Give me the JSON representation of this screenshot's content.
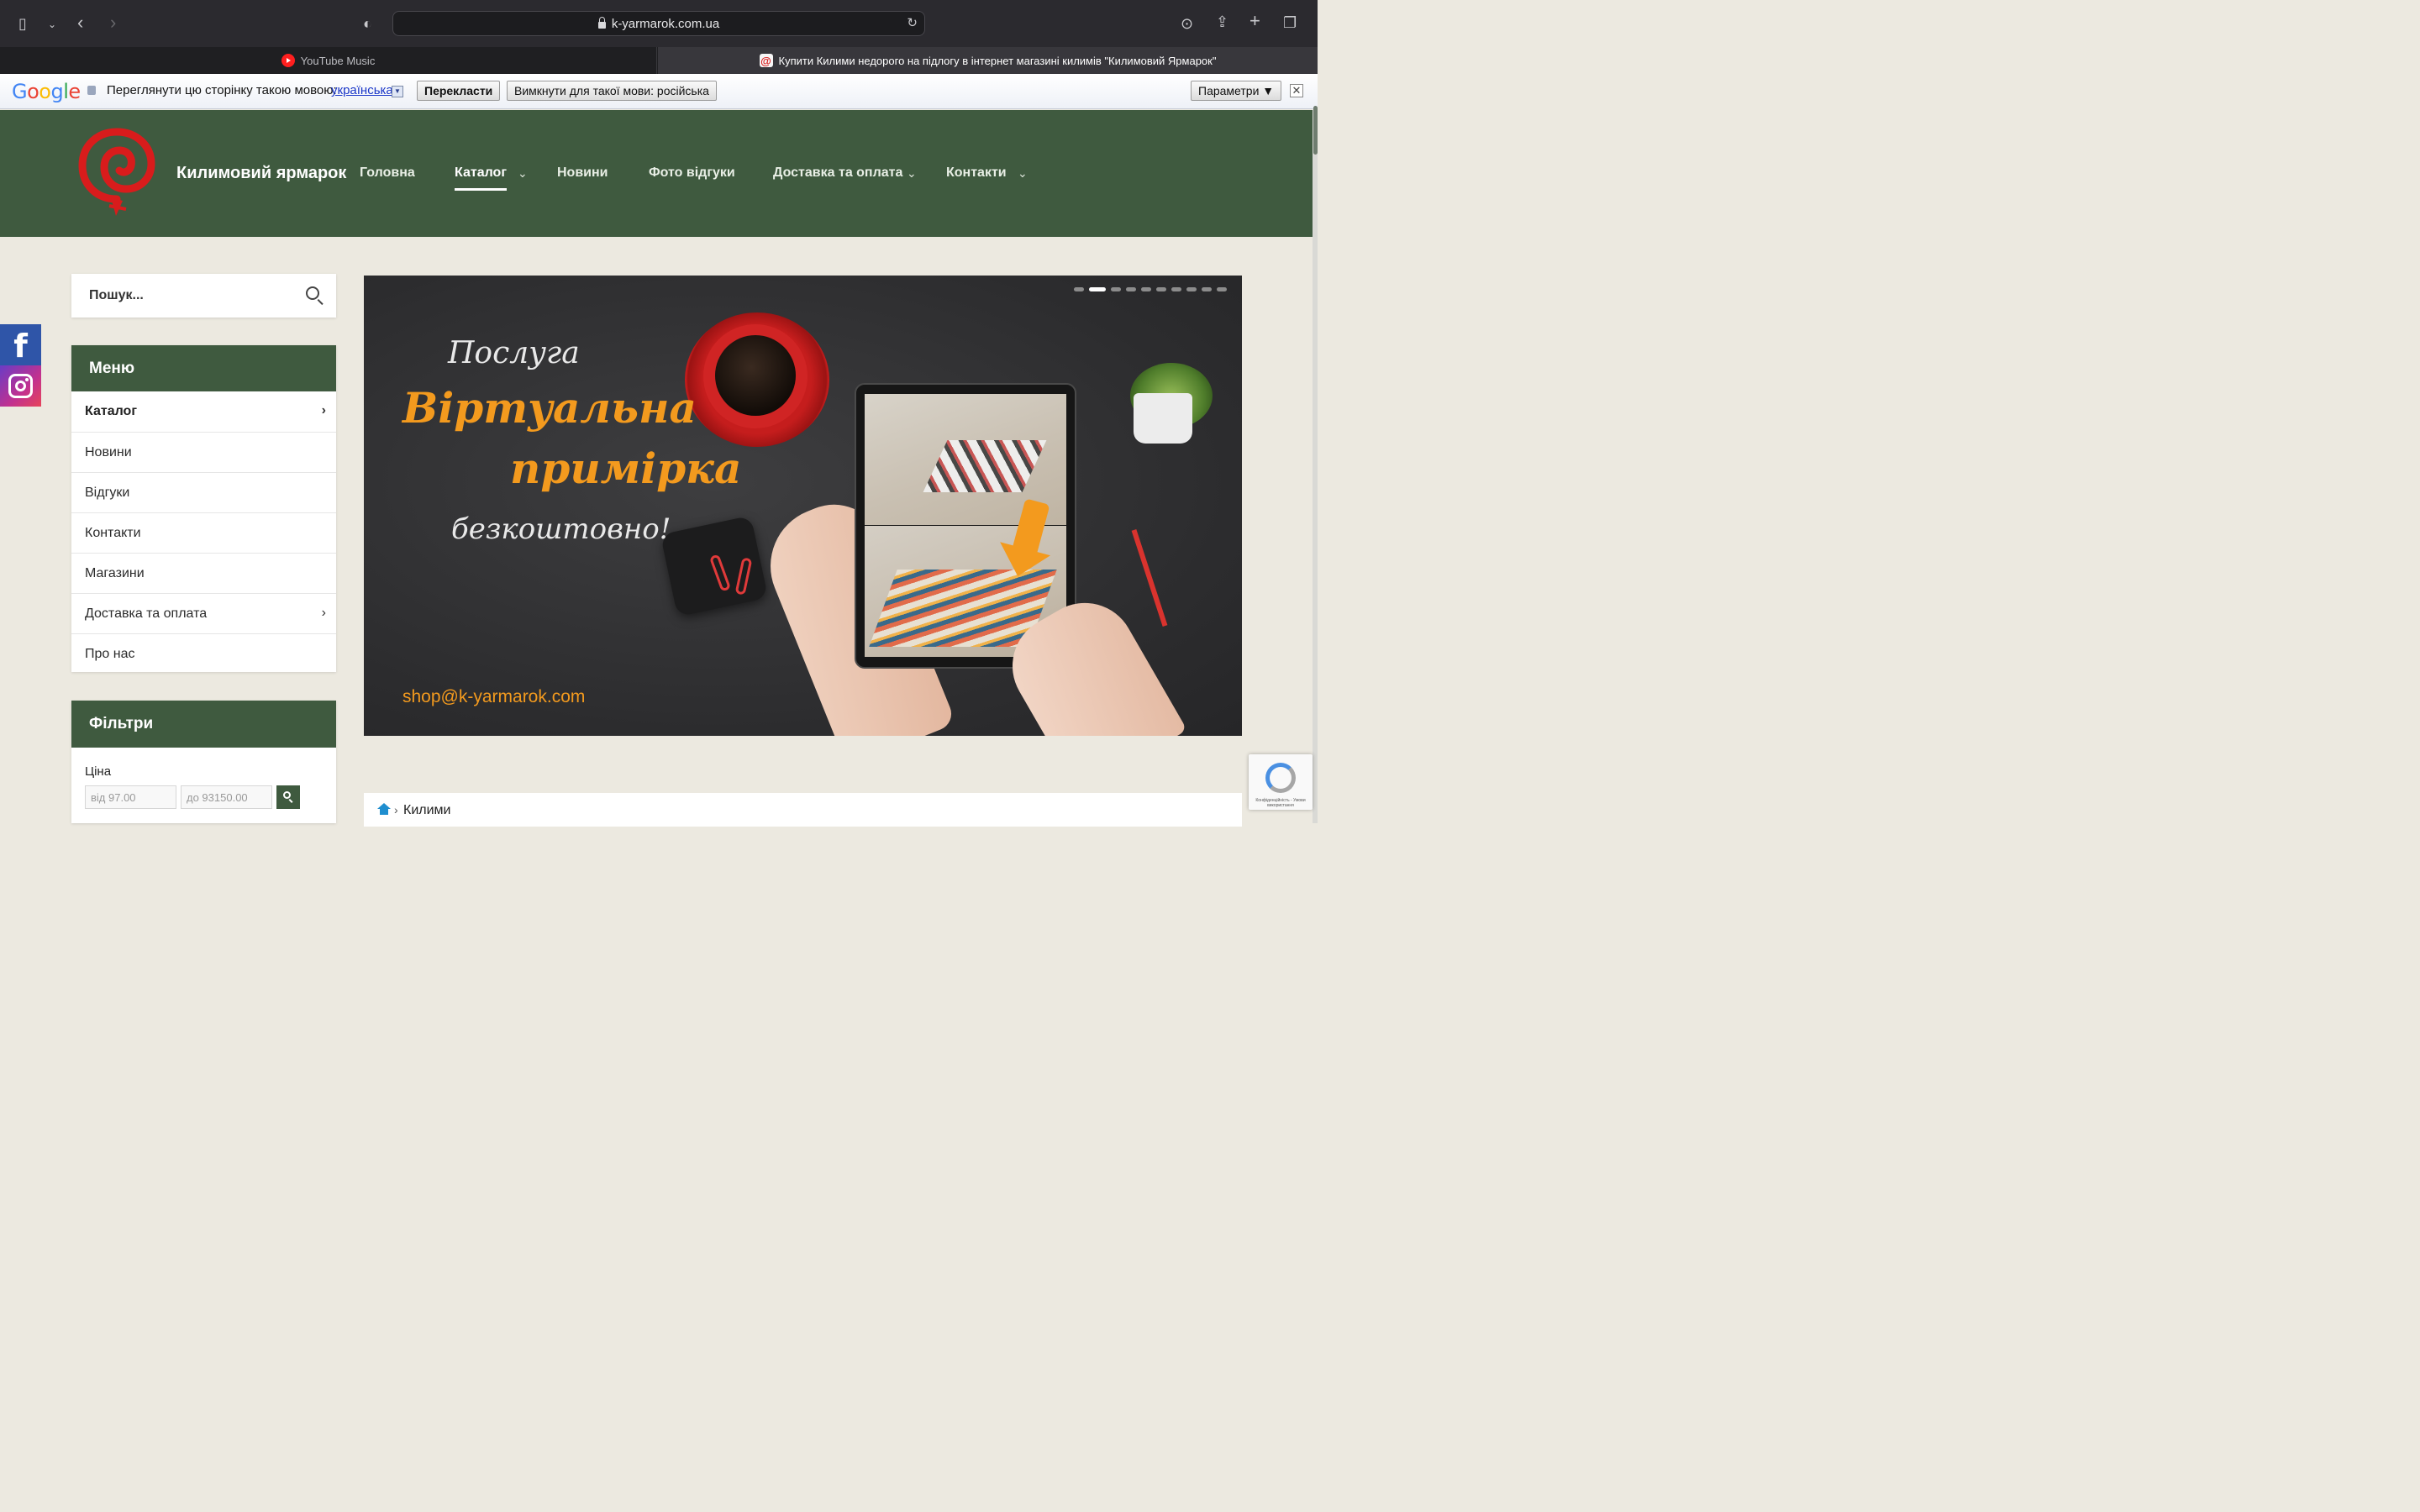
{
  "browser": {
    "url": "k-yarmarok.com.ua",
    "tabs": [
      {
        "label": "YouTube Music",
        "active": false
      },
      {
        "label": "Купити Килими недорого на підлогу в інтернет магазині килимів \"Килимовий Ярмарок\"",
        "active": true
      }
    ]
  },
  "translate_bar": {
    "brand": "Google",
    "prompt": "Переглянути цю сторінку такою мовою:",
    "language": "українська",
    "translate_button": "Перекласти",
    "disable_button": "Вимкнути для такої мови: російська",
    "options_button": "Параметри ▼",
    "close": "✕"
  },
  "site": {
    "brand": "Килимовий ярмарок",
    "nav": [
      {
        "label": "Головна",
        "active": false,
        "dropdown": false
      },
      {
        "label": "Каталог",
        "active": true,
        "dropdown": true
      },
      {
        "label": "Новини",
        "active": false,
        "dropdown": false
      },
      {
        "label": "Фото відгуки",
        "active": false,
        "dropdown": false
      },
      {
        "label": "Доставка та оплата",
        "active": false,
        "dropdown": true
      },
      {
        "label": "Контакти",
        "active": false,
        "dropdown": true
      }
    ],
    "colors": {
      "header": "#3f5a3f",
      "accent": "#f39a1e",
      "logo": "#d81c1c"
    }
  },
  "social": {
    "facebook": "f",
    "instagram": "instagram-icon"
  },
  "sidebar": {
    "search": {
      "placeholder": "Пошук..."
    },
    "menu": {
      "title": "Меню",
      "items": [
        {
          "label": "Каталог",
          "arrow": true
        },
        {
          "label": "Новини",
          "arrow": false
        },
        {
          "label": "Відгуки",
          "arrow": false
        },
        {
          "label": "Контакти",
          "arrow": false
        },
        {
          "label": "Магазини",
          "arrow": false
        },
        {
          "label": "Доставка та оплата",
          "arrow": true
        },
        {
          "label": "Про нас",
          "arrow": false
        }
      ]
    },
    "filters": {
      "title": "Фільтри",
      "price_label": "Ціна",
      "price_from": "від 97.00",
      "price_to": "до 93150.00"
    }
  },
  "banner": {
    "line1": "Послуга",
    "line2": "Віртуальна",
    "line3": "примірка",
    "line4": "безкоштовно!",
    "email": "shop@k-yarmarok.com",
    "slides_total": 10,
    "slide_active": 2
  },
  "breadcrumb": {
    "separator": "›",
    "current": "Килими"
  },
  "recaptcha": {
    "text": "Конфіденційність - Умови використання"
  }
}
